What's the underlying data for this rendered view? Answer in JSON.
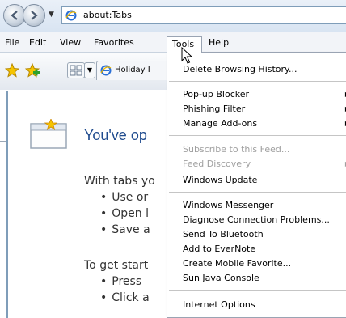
{
  "window": {
    "address": "about:Tabs"
  },
  "menubar": {
    "items": [
      "File",
      "Edit",
      "View",
      "Favorites",
      "Tools",
      "Help"
    ],
    "active": "Tools"
  },
  "tabs": [
    {
      "label": "Holiday I"
    }
  ],
  "page": {
    "title": "You've op",
    "lines": [
      "With tabs yo",
      "Use or",
      "Open l",
      "Save a",
      "To get start",
      "Press",
      "Click a"
    ]
  },
  "tools_menu": {
    "items": [
      {
        "label": "Delete Browsing History...",
        "disabled": false,
        "submenu": false
      },
      {
        "label": "Pop-up Blocker",
        "disabled": false,
        "submenu": true
      },
      {
        "label": "Phishing Filter",
        "disabled": false,
        "submenu": true
      },
      {
        "label": "Manage Add-ons",
        "disabled": false,
        "submenu": true
      },
      {
        "label": "Subscribe to this Feed...",
        "disabled": true,
        "submenu": false
      },
      {
        "label": "Feed Discovery",
        "disabled": true,
        "submenu": true
      },
      {
        "label": "Windows Update",
        "disabled": false,
        "submenu": false
      },
      {
        "label": "Windows Messenger",
        "disabled": false,
        "submenu": false
      },
      {
        "label": "Diagnose Connection Problems...",
        "disabled": false,
        "submenu": false
      },
      {
        "label": "Send To Bluetooth",
        "disabled": false,
        "submenu": false
      },
      {
        "label": "Add to EverNote",
        "disabled": false,
        "submenu": false
      },
      {
        "label": "Create Mobile Favorite...",
        "disabled": false,
        "submenu": false
      },
      {
        "label": "Sun Java Console",
        "disabled": false,
        "submenu": false
      },
      {
        "label": "Internet Options",
        "disabled": false,
        "submenu": false
      }
    ]
  },
  "colors": {
    "title_blue": "#1f4b8e",
    "disabled_gray": "#a0a0a0"
  },
  "icons": {
    "back": "back-arrow-icon",
    "forward": "forward-arrow-icon",
    "ie": "ie-logo-icon",
    "favorites_center": "favorites-star-icon",
    "add_favorite": "add-favorite-icon",
    "quick_tabs": "quick-tabs-icon",
    "cursor": "mouse-pointer-icon"
  }
}
